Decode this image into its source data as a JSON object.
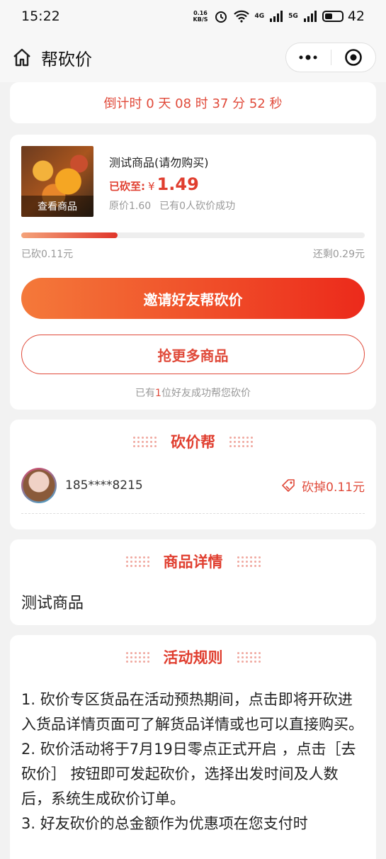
{
  "status_bar": {
    "time": "15:22",
    "net_speed_top": "0.16",
    "net_speed_bottom": "KB/S",
    "net_4g": "4G",
    "net_5g": "5G",
    "battery": "42"
  },
  "nav": {
    "title": "帮砍价"
  },
  "countdown": {
    "text": "倒计时 0 天 08 时 37 分 52 秒"
  },
  "product": {
    "thumb_label": "查看商品",
    "name": "测试商品(请勿购买)",
    "cut_label": "已砍至:",
    "currency": "¥",
    "cut_price": "1.49",
    "original_price": "原价1.60",
    "success_count": "已有0人砍价成功",
    "progress_fraction": 0.28,
    "cut_amount": "已砍0.11元",
    "remaining": "还剩0.29元",
    "invite_button": "邀请好友帮砍价",
    "more_button": "抢更多商品",
    "helped_prefix": "已有",
    "helped_count": "1",
    "helped_suffix": "位好友成功帮您砍价"
  },
  "helpers": {
    "title": "砍价帮",
    "items": [
      {
        "name": "185****8215",
        "cut": "砍掉0.11元"
      }
    ]
  },
  "details": {
    "title": "商品详情",
    "text": "测试商品"
  },
  "rules": {
    "title": "活动规则",
    "lines": [
      "1. 砍价专区货品在活动预热期间，点击即将开砍进入货品详情页面可了解货品详情或也可以直接购买。",
      "2. 砍价活动将于7月19日零点正式开启 ，点击［去砍价］ 按钮即可发起砍价，选择出发时间及人数后，系统生成砍价订单。",
      "3. 好友砍价的总金额作为优惠项在您支付时"
    ]
  },
  "colors": {
    "accent": "#e04a3a",
    "gradient_start": "#f4793a",
    "gradient_end": "#ec2a1b"
  }
}
